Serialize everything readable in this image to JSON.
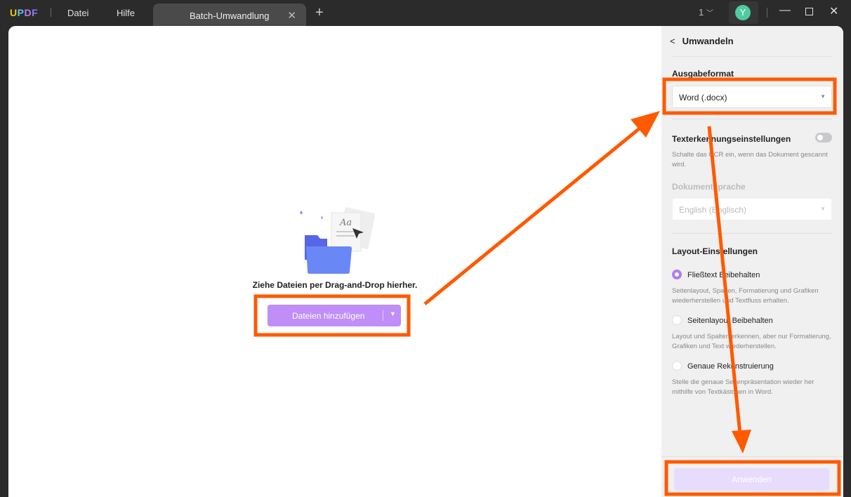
{
  "titlebar": {
    "logo": "UPDF",
    "menu": [
      "Datei",
      "Hilfe"
    ],
    "tab": "Batch-Umwandlung",
    "page_indicator": "1",
    "avatar_letter": "Y"
  },
  "center": {
    "drop_text": "Ziehe Dateien per Drag-and-Drop hierher.",
    "add_button": "Dateien hinzufügen",
    "illustration_label": "Aa"
  },
  "panel": {
    "title": "Umwandeln",
    "output_format_label": "Ausgabeformat",
    "output_format_value": "Word (.docx)",
    "ocr_label": "Texterkennungseinstellungen",
    "ocr_enabled": false,
    "ocr_desc": "Schalte das OCR ein, wenn das Dokument gescannt wird.",
    "lang_label": "Dokumentsprache",
    "lang_value": "English (Englisch)",
    "layout_label": "Layout-Einstellungen",
    "options": [
      {
        "label": "Fließtext Beibehalten",
        "desc": "Seitenlayout, Spalten, Formatierung und Grafiken wiederherstellen und Textfluss erhalten.",
        "selected": true
      },
      {
        "label": "Seitenlayout Beibehalten",
        "desc": "Layout und Spalten erkennen, aber nur Formatierung, Grafiken und Text wiederherstellen.",
        "selected": false
      },
      {
        "label": "Genaue Rekonstruierung",
        "desc": "Stelle die genaue Seitenpräsentation wieder her mithilfe von Textkästchen in Word.",
        "selected": false
      }
    ],
    "apply_button": "Anwenden"
  },
  "colors": {
    "accent": "#b27cf5",
    "annotation": "#ff5a00",
    "titlebar": "#2b2b2b"
  }
}
